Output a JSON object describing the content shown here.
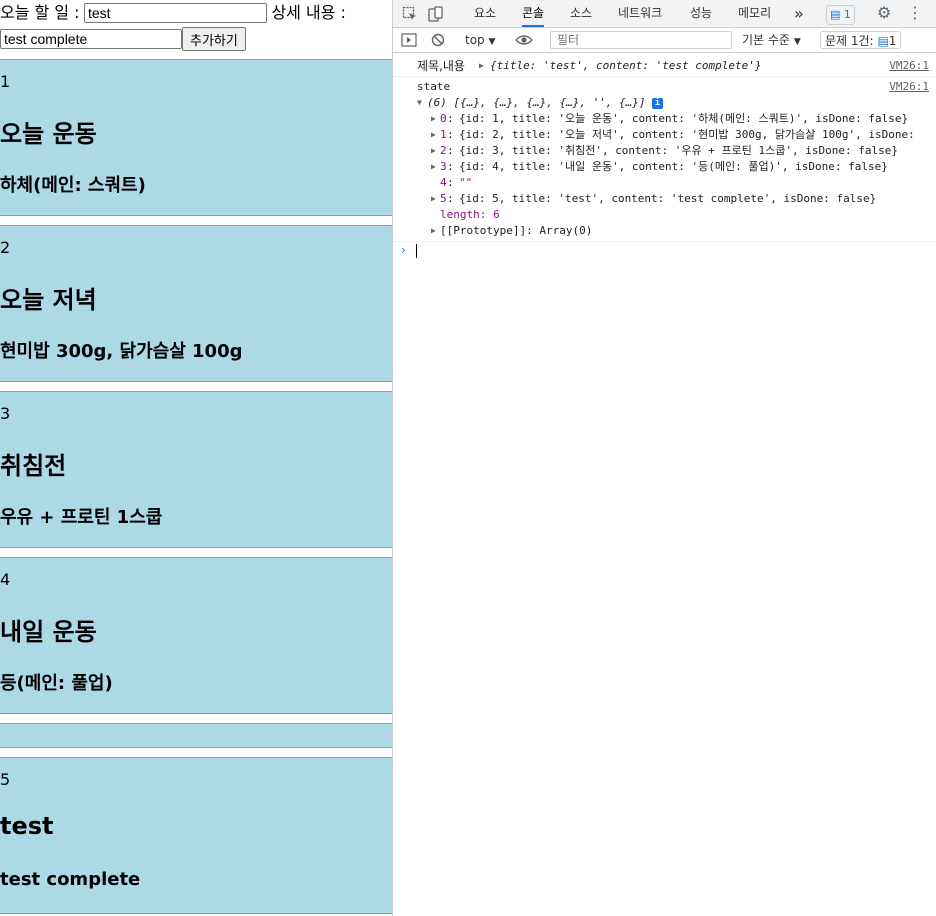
{
  "app": {
    "title_label": "오늘 할 일 :",
    "title_value": "test",
    "content_label": "상세 내용 :",
    "content_value": "test complete",
    "add_button": "추가하기",
    "todos": [
      {
        "id": "1",
        "title": "오늘 운동",
        "content": "하체(메인: 스쿼트)"
      },
      {
        "id": "2",
        "title": "오늘 저녁",
        "content": "현미밥 300g, 닭가슴살 100g"
      },
      {
        "id": "3",
        "title": "취침전",
        "content": "우유 + 프로틴 1스쿱"
      },
      {
        "id": "4",
        "title": "내일 운동",
        "content": "등(메인: 풀업)"
      },
      {
        "id": "",
        "title": "",
        "content": ""
      },
      {
        "id": "5",
        "title": "test",
        "content": "test complete"
      }
    ],
    "card_color": "#add8e6"
  },
  "devtools": {
    "tabs": [
      "요소",
      "콘솔",
      "소스",
      "네트워크",
      "성능",
      "메모리"
    ],
    "active_tab": "콘솔",
    "more_tabs": "»",
    "messages_badge": "1",
    "context": "top",
    "filter_placeholder": "필터",
    "levels": "기본 수준",
    "issues_label": "문제 1건:",
    "issues_count": "1",
    "console": {
      "log1_label": "제목,내용",
      "log1_object": "{title: 'test', content: 'test complete'}",
      "log1_source": "VM26:1",
      "log2_label": "state",
      "log2_source": "VM26:1",
      "array_summary": "(6) [{…}, {…}, {…}, {…}, '', {…}]",
      "info_badge": "i",
      "entries": [
        {
          "index": "0",
          "text": "{id: 1, title: '오늘 운동', content: '하체(메인: 스쿼트)', isDone: false}"
        },
        {
          "index": "1",
          "text": "{id: 2, title: '오늘 저녁', content: '현미밥 300g, 닭가슴살 100g', isDone:"
        },
        {
          "index": "2",
          "text": "{id: 3, title: '취침전', content: '우유 + 프로틴 1스쿱', isDone: false}"
        },
        {
          "index": "3",
          "text": "{id: 4, title: '내일 운동', content: '등(메인: 풀업)', isDone: false}"
        },
        {
          "index": "4",
          "text": "\"\""
        },
        {
          "index": "5",
          "text": "{id: 5, title: 'test', content: 'test complete', isDone: false}"
        }
      ],
      "length_line": "length: 6",
      "prototype_line": "[[Prototype]]: Array(0)",
      "prompt": "›"
    },
    "accent_color": "#1a73e8"
  }
}
